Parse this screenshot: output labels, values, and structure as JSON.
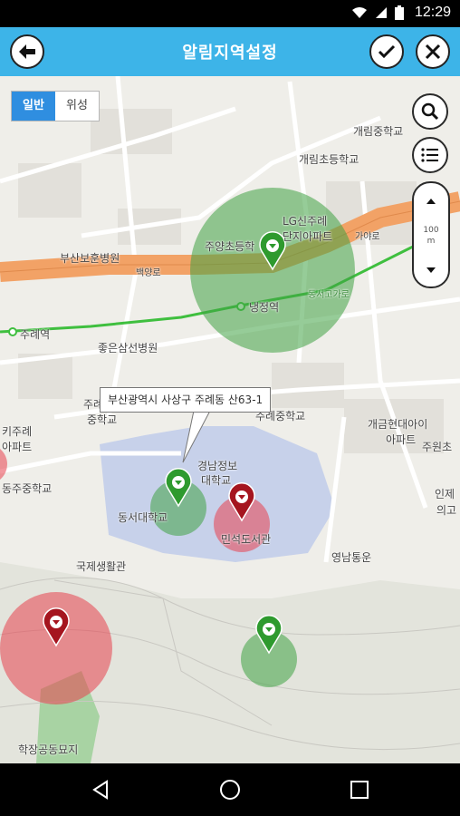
{
  "status_bar": {
    "time": "12:29",
    "icons": [
      "wifi-icon",
      "signal-icon",
      "battery-icon"
    ]
  },
  "app_bar": {
    "title": "알림지역설정",
    "back_icon": "arrow-left-icon",
    "confirm_icon": "check-icon",
    "close_icon": "close-icon"
  },
  "map_type": {
    "normal": "일반",
    "satellite": "위성"
  },
  "zoom": {
    "scale_value": "100",
    "scale_unit": "m"
  },
  "callout": {
    "address": "부산광역시 사상구 주례동 산63-1"
  },
  "map_labels": {
    "gaerim_middle": "개림중학교",
    "gaerim_elem": "개림초등학교",
    "lg_apt_1": "LG신주례",
    "lg_apt_2": "단지아파트",
    "juyang_elem": "주양초등학",
    "busan_hospital": "부산보훈병원",
    "naengjeong_station": "냉정역",
    "jurye_station": "주례역",
    "joeun_hospital": "좋은삼선병원",
    "jurye_middle_a": "주례",
    "jurye_middle_b": "중학교",
    "jurye_middle_c": "주례중학교",
    "gaegeum_apt_1": "개금현대아이",
    "gaegeum_apt_2": "아파트",
    "juwon": "주원초",
    "kiju_apt_1": "키주례",
    "kiju_apt_2": "아파트",
    "dongju_middle": "동주중학교",
    "kyungnam_univ_1": "경남정보",
    "kyungnam_univ_2": "대학교",
    "dongseo_univ": "동서대학교",
    "minseok_library": "민석도서관",
    "international_hall": "국제생활관",
    "yeongnam": "영남통운",
    "inje_1": "인제",
    "inje_2": "의고",
    "hakjang_cemetery": "학장공동묘지",
    "gaya_road": "가야로",
    "dongseo_expressway": "동서고가로",
    "baekyang_road": "백양로"
  },
  "colors": {
    "app_bar": "#3db4e8",
    "map_bg": "#efeee9",
    "highway": "#f2a266",
    "green_zone": "#3fa243",
    "red_zone": "#e8414f",
    "subway": "#3fbf3f"
  }
}
